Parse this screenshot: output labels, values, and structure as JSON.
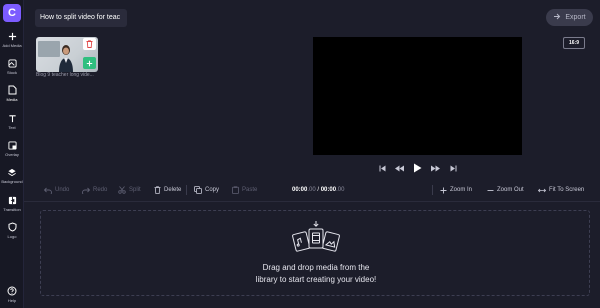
{
  "app": {
    "logo_letter": "C",
    "accent": "#7c5cff"
  },
  "sidebar": {
    "items": [
      {
        "label": "Add Media",
        "icon": "plus-icon"
      },
      {
        "label": "Stock",
        "icon": "stock-icon"
      },
      {
        "label": "Media",
        "icon": "file-icon",
        "active": true
      },
      {
        "label": "Text",
        "icon": "text-icon"
      },
      {
        "label": "Overlay",
        "icon": "overlay-icon"
      },
      {
        "label": "Background",
        "icon": "layers-icon"
      },
      {
        "label": "Transition",
        "icon": "transition-icon"
      },
      {
        "label": "Logo",
        "icon": "shield-icon"
      },
      {
        "label": "Help",
        "icon": "help-icon"
      }
    ]
  },
  "header": {
    "project_title": "How to split video for teac",
    "export_label": "Export"
  },
  "media": {
    "caption": "Blog 9 teacher long vide..."
  },
  "preview": {
    "aspect_ratio": "16:9"
  },
  "toolbar": {
    "undo": "Undo",
    "redo": "Redo",
    "split": "Split",
    "delete": "Delete",
    "copy": "Copy",
    "paste": "Paste",
    "time_current": "00:00",
    "time_current_frac": ".00",
    "time_sep": " / ",
    "time_total": "00:00",
    "time_total_frac": ".00",
    "zoom_in": "Zoom In",
    "zoom_out": "Zoom Out",
    "fit": "Fit To Screen"
  },
  "timeline": {
    "drop_line1": "Drag and drop media from the",
    "drop_line2": "library to start creating your video!"
  }
}
